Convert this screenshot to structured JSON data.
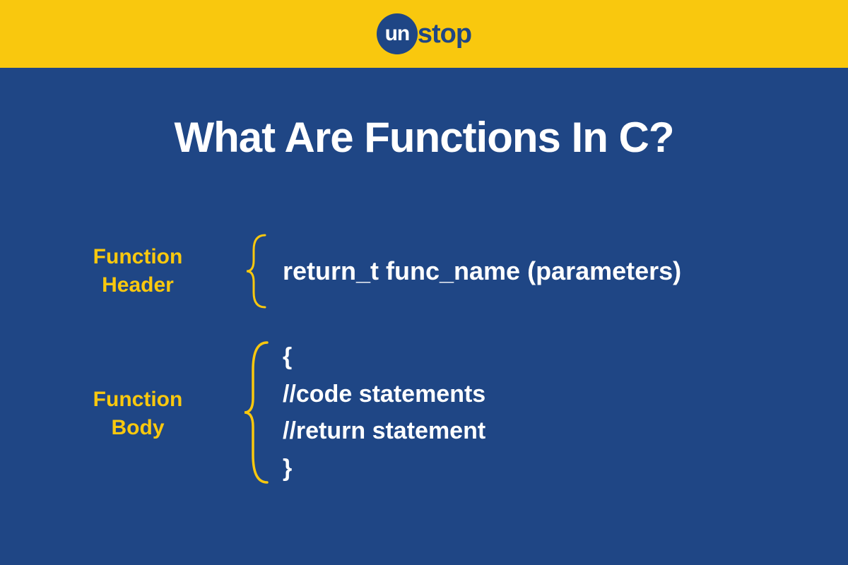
{
  "brand": {
    "circle_text": "un",
    "suffix_text": "stop"
  },
  "title": "What Are Functions In C?",
  "sections": {
    "header": {
      "label_line1": "Function",
      "label_line2": "Header",
      "code": "return_t func_name (parameters)"
    },
    "body": {
      "label_line1": "Function",
      "label_line2": "Body",
      "code_line1": "{",
      "code_line2": "//code statements",
      "code_line3": "//return statement",
      "code_line4": "}"
    }
  },
  "colors": {
    "background": "#1f4685",
    "accent": "#f9c80e",
    "text": "#ffffff"
  }
}
